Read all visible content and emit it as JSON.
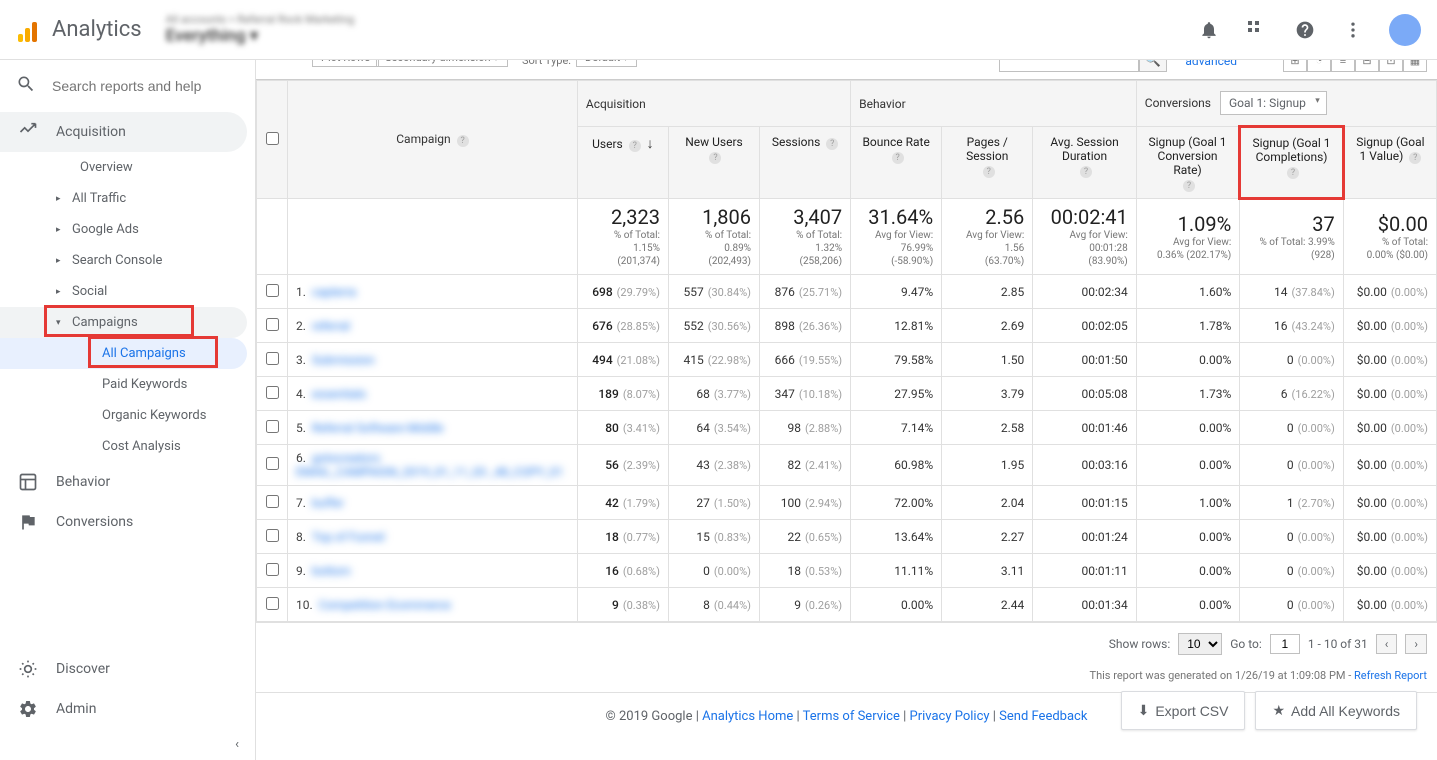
{
  "header": {
    "product": "Analytics",
    "account_line1": "All accounts > Referral Rock Marketing",
    "account_line2": "Everything ▾",
    "search_placeholder": "Search reports and help"
  },
  "sidebar": {
    "acquisition": "Acquisition",
    "overview": "Overview",
    "all_traffic": "All Traffic",
    "google_ads": "Google Ads",
    "search_console": "Search Console",
    "social": "Social",
    "campaigns": "Campaigns",
    "all_campaigns": "All Campaigns",
    "paid_keywords": "Paid Keywords",
    "organic_keywords": "Organic Keywords",
    "cost_analysis": "Cost Analysis",
    "behavior": "Behavior",
    "conversions": "Conversions",
    "discover": "Discover",
    "admin": "Admin"
  },
  "toolbar": {
    "advanced": "advanced"
  },
  "table": {
    "campaign_header": "Campaign",
    "groups": {
      "acquisition": "Acquisition",
      "behavior": "Behavior",
      "conversions": "Conversions"
    },
    "goal_select": "Goal 1: Signup",
    "columns": {
      "users": "Users",
      "new_users": "New Users",
      "sessions": "Sessions",
      "bounce_rate": "Bounce Rate",
      "pages_session": "Pages / Session",
      "avg_duration": "Avg. Session Duration",
      "conv_rate": "Signup (Goal 1 Conversion Rate)",
      "completions": "Signup (Goal 1 Completions)",
      "value": "Signup (Goal 1 Value)"
    },
    "totals": {
      "users": {
        "big": "2,323",
        "l1": "% of Total:",
        "l2": "1.15%",
        "l3": "(201,374)"
      },
      "new_users": {
        "big": "1,806",
        "l1": "% of Total:",
        "l2": "0.89%",
        "l3": "(202,493)"
      },
      "sessions": {
        "big": "3,407",
        "l1": "% of Total:",
        "l2": "1.32%",
        "l3": "(258,206)"
      },
      "bounce_rate": {
        "big": "31.64%",
        "l1": "Avg for View:",
        "l2": "76.99%",
        "l3": "(-58.90%)"
      },
      "pages_session": {
        "big": "2.56",
        "l1": "Avg for View:",
        "l2": "1.56",
        "l3": "(63.70%)"
      },
      "avg_duration": {
        "big": "00:02:41",
        "l1": "Avg for View:",
        "l2": "00:01:28",
        "l3": "(83.90%)"
      },
      "conv_rate": {
        "big": "1.09%",
        "l1": "Avg for View:",
        "l2": "0.36% (202.17%)",
        "l3": ""
      },
      "completions": {
        "big": "37",
        "l1": "% of Total: 3.99%",
        "l2": "(928)",
        "l3": ""
      },
      "value": {
        "big": "$0.00",
        "l1": "% of Total:",
        "l2": "0.00% ($0.00)",
        "l3": ""
      }
    },
    "rows": [
      {
        "idx": "1.",
        "name": "capterra",
        "users": "698",
        "users_p": "(29.79%)",
        "nu": "557",
        "nu_p": "(30.84%)",
        "s": "876",
        "s_p": "(25.71%)",
        "br": "9.47%",
        "ps": "2.85",
        "dur": "00:02:34",
        "cr": "1.60%",
        "comp": "14",
        "comp_p": "(37.84%)",
        "val": "$0.00",
        "val_p": "(0.00%)"
      },
      {
        "idx": "2.",
        "name": "referral",
        "users": "676",
        "users_p": "(28.85%)",
        "nu": "552",
        "nu_p": "(30.56%)",
        "s": "898",
        "s_p": "(26.36%)",
        "br": "12.81%",
        "ps": "2.69",
        "dur": "00:02:05",
        "cr": "1.78%",
        "comp": "16",
        "comp_p": "(43.24%)",
        "val": "$0.00",
        "val_p": "(0.00%)"
      },
      {
        "idx": "3.",
        "name": "Submission",
        "users": "494",
        "users_p": "(21.08%)",
        "nu": "415",
        "nu_p": "(22.98%)",
        "s": "666",
        "s_p": "(19.55%)",
        "br": "79.58%",
        "ps": "1.50",
        "dur": "00:01:50",
        "cr": "0.00%",
        "comp": "0",
        "comp_p": "(0.00%)",
        "val": "$0.00",
        "val_p": "(0.00%)"
      },
      {
        "idx": "4.",
        "name": "essentials",
        "users": "189",
        "users_p": "(8.07%)",
        "nu": "68",
        "nu_p": "(3.77%)",
        "s": "347",
        "s_p": "(10.18%)",
        "br": "27.95%",
        "ps": "3.79",
        "dur": "00:05:08",
        "cr": "1.73%",
        "comp": "6",
        "comp_p": "(16.22%)",
        "val": "$0.00",
        "val_p": "(0.00%)"
      },
      {
        "idx": "5.",
        "name": "Referral Software Middle",
        "users": "80",
        "users_p": "(3.41%)",
        "nu": "64",
        "nu_p": "(3.54%)",
        "s": "98",
        "s_p": "(2.88%)",
        "br": "7.14%",
        "ps": "2.58",
        "dur": "00:01:46",
        "cr": "0.00%",
        "comp": "0",
        "comp_p": "(0.00%)",
        "val": "$0.00",
        "val_p": "(0.00%)"
      },
      {
        "idx": "6.",
        "name": "gotocreators EMAIL_CAMPAIGN_2019_01_11_03 _48_COPY_01",
        "users": "56",
        "users_p": "(2.39%)",
        "nu": "43",
        "nu_p": "(2.38%)",
        "s": "82",
        "s_p": "(2.41%)",
        "br": "60.98%",
        "ps": "1.95",
        "dur": "00:03:16",
        "cr": "0.00%",
        "comp": "0",
        "comp_p": "(0.00%)",
        "val": "$0.00",
        "val_p": "(0.00%)"
      },
      {
        "idx": "7.",
        "name": "buffer",
        "users": "42",
        "users_p": "(1.79%)",
        "nu": "27",
        "nu_p": "(1.50%)",
        "s": "100",
        "s_p": "(2.94%)",
        "br": "72.00%",
        "ps": "2.04",
        "dur": "00:01:15",
        "cr": "1.00%",
        "comp": "1",
        "comp_p": "(2.70%)",
        "val": "$0.00",
        "val_p": "(0.00%)"
      },
      {
        "idx": "8.",
        "name": "Top of Funnel",
        "users": "18",
        "users_p": "(0.77%)",
        "nu": "15",
        "nu_p": "(0.83%)",
        "s": "22",
        "s_p": "(0.65%)",
        "br": "13.64%",
        "ps": "2.27",
        "dur": "00:01:24",
        "cr": "0.00%",
        "comp": "0",
        "comp_p": "(0.00%)",
        "val": "$0.00",
        "val_p": "(0.00%)"
      },
      {
        "idx": "9.",
        "name": "bottom",
        "users": "16",
        "users_p": "(0.68%)",
        "nu": "0",
        "nu_p": "(0.00%)",
        "s": "18",
        "s_p": "(0.53%)",
        "br": "11.11%",
        "ps": "3.11",
        "dur": "00:01:11",
        "cr": "0.00%",
        "comp": "0",
        "comp_p": "(0.00%)",
        "val": "$0.00",
        "val_p": "(0.00%)"
      },
      {
        "idx": "10.",
        "name": "Competition Ecommerce",
        "users": "9",
        "users_p": "(0.38%)",
        "nu": "8",
        "nu_p": "(0.44%)",
        "s": "9",
        "s_p": "(0.26%)",
        "br": "0.00%",
        "ps": "2.44",
        "dur": "00:01:34",
        "cr": "0.00%",
        "comp": "0",
        "comp_p": "(0.00%)",
        "val": "$0.00",
        "val_p": "(0.00%)"
      }
    ]
  },
  "pagination": {
    "show_rows": "Show rows:",
    "rows_value": "10",
    "goto": "Go to:",
    "goto_value": "1",
    "range": "1 - 10 of 31"
  },
  "report_gen": {
    "text": "This report was generated on 1/26/19 at 1:09:08 PM - ",
    "link": "Refresh Report"
  },
  "actions": {
    "export": "Export CSV",
    "add_keywords": "Add All Keywords"
  },
  "footer": {
    "copyright": "© 2019 Google",
    "links": [
      "Analytics Home",
      "Terms of Service",
      "Privacy Policy",
      "Send Feedback"
    ]
  }
}
